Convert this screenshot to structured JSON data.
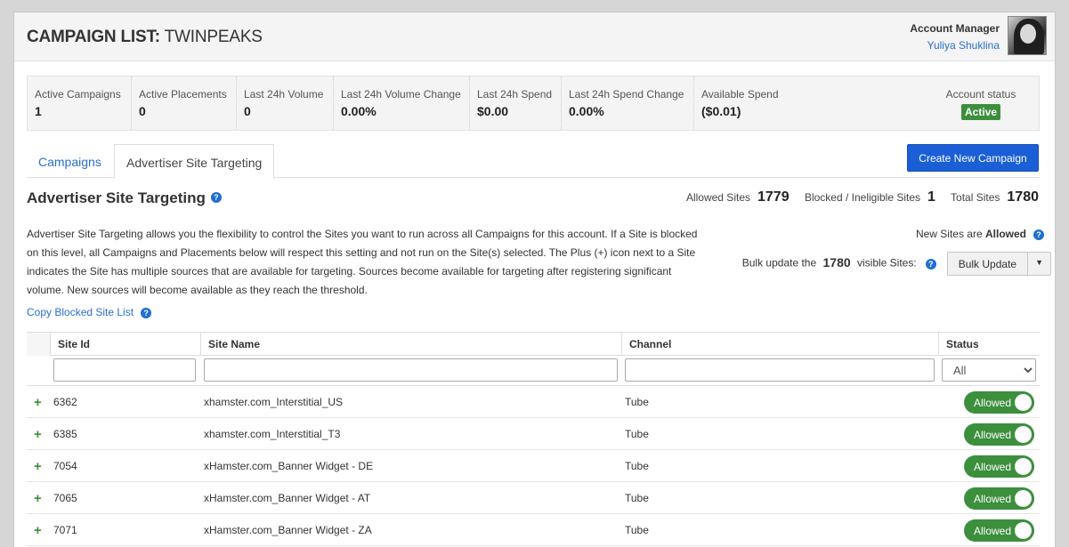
{
  "header": {
    "title_prefix": "CAMPAIGN LIST:",
    "title_name": "TWINPEAKS",
    "account_role": "Account Manager",
    "account_name": "Yuliya Shuklina"
  },
  "stats": [
    {
      "label": "Active Campaigns",
      "value": "1"
    },
    {
      "label": "Active Placements",
      "value": "0"
    },
    {
      "label": "Last 24h Volume",
      "value": "0"
    },
    {
      "label": "Last 24h Volume Change",
      "value": "0.00%"
    },
    {
      "label": "Last 24h Spend",
      "value": "$0.00"
    },
    {
      "label": "Last 24h Spend Change",
      "value": "0.00%"
    },
    {
      "label": "Available Spend",
      "value": "($0.01)"
    }
  ],
  "account_status": {
    "label": "Account status",
    "value": "Active"
  },
  "tabs": [
    {
      "label": "Campaigns"
    },
    {
      "label": "Advertiser Site Targeting"
    }
  ],
  "create_button": "Create New Campaign",
  "section": {
    "title": "Advertiser Site Targeting",
    "allowed_label": "Allowed Sites",
    "allowed_value": "1779",
    "blocked_label": "Blocked / Ineligible Sites",
    "blocked_value": "1",
    "total_label": "Total Sites",
    "total_value": "1780",
    "description": "Advertiser Site Targeting allows you the flexibility to control the Sites you want to run across all Campaigns for this account. If a Site is blocked on this level, all Campaigns and Placements below will respect this setting and not run on the Site(s) selected. The Plus (+) icon next to a Site indicates the Site has multiple sources that are available for targeting. Sources become available for targeting after registering significant volume. New sources will become available as they reach the threshold.",
    "copy_link": "Copy Blocked Site List",
    "new_sites_prefix": "New Sites are",
    "new_sites_value": "Allowed",
    "bulk_prefix": "Bulk update the",
    "bulk_count": "1780",
    "bulk_suffix": "visible Sites:",
    "bulk_button": "Bulk Update"
  },
  "table": {
    "columns": [
      "Site Id",
      "Site Name",
      "Channel",
      "Status"
    ],
    "status_filter": "All",
    "rows": [
      {
        "id": "6362",
        "name": "xhamster.com_Interstitial_US",
        "channel": "Tube",
        "status": "Allowed"
      },
      {
        "id": "6385",
        "name": "xhamster.com_Interstitial_T3",
        "channel": "Tube",
        "status": "Allowed"
      },
      {
        "id": "7054",
        "name": "xHamster.com_Banner Widget - DE",
        "channel": "Tube",
        "status": "Allowed"
      },
      {
        "id": "7065",
        "name": "xHamster.com_Banner Widget - AT",
        "channel": "Tube",
        "status": "Allowed"
      },
      {
        "id": "7071",
        "name": "xHamster.com_Banner Widget - ZA",
        "channel": "Tube",
        "status": "Allowed"
      }
    ]
  }
}
